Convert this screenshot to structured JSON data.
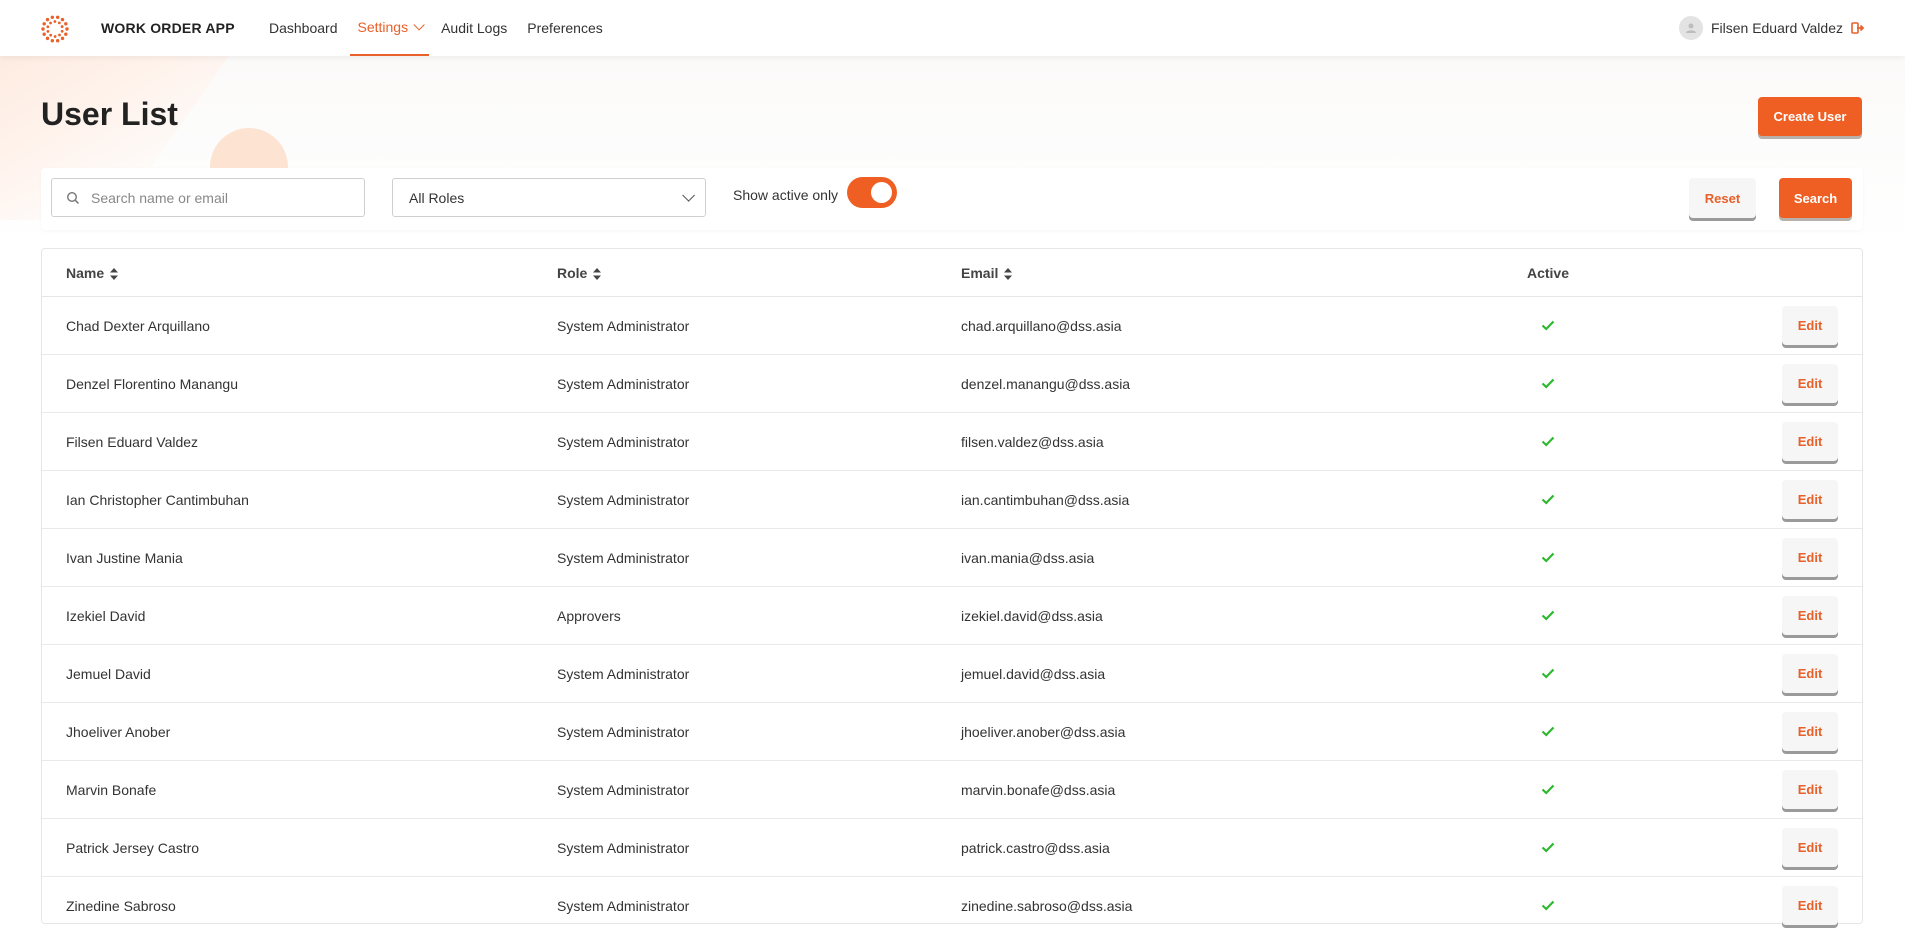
{
  "header": {
    "app_title": "WORK ORDER APP",
    "nav": [
      {
        "label": "Dashboard",
        "active": false
      },
      {
        "label": "Settings",
        "active": true
      },
      {
        "label": "Audit Logs",
        "active": false
      },
      {
        "label": "Preferences",
        "active": false
      }
    ],
    "user_name": "Filsen Eduard Valdez"
  },
  "page": {
    "title": "User List",
    "create_button": "Create User"
  },
  "filters": {
    "search_placeholder": "Search name or email",
    "role_selected": "All Roles",
    "toggle_label": "Show active only",
    "toggle_on": true,
    "reset_label": "Reset",
    "search_label": "Search"
  },
  "table": {
    "headers": {
      "name": "Name",
      "role": "Role",
      "email": "Email",
      "active": "Active"
    },
    "edit_label": "Edit",
    "rows": [
      {
        "name": "Chad Dexter Arquillano",
        "role": "System Administrator",
        "email": "chad.arquillano@dss.asia",
        "active": true
      },
      {
        "name": "Denzel Florentino Manangu",
        "role": "System Administrator",
        "email": "denzel.manangu@dss.asia",
        "active": true
      },
      {
        "name": "Filsen Eduard Valdez",
        "role": "System Administrator",
        "email": "filsen.valdez@dss.asia",
        "active": true
      },
      {
        "name": "Ian Christopher Cantimbuhan",
        "role": "System Administrator",
        "email": "ian.cantimbuhan@dss.asia",
        "active": true
      },
      {
        "name": "Ivan Justine Mania",
        "role": "System Administrator",
        "email": "ivan.mania@dss.asia",
        "active": true
      },
      {
        "name": "Izekiel David",
        "role": "Approvers",
        "email": "izekiel.david@dss.asia",
        "active": true
      },
      {
        "name": "Jemuel David",
        "role": "System Administrator",
        "email": "jemuel.david@dss.asia",
        "active": true
      },
      {
        "name": "Jhoeliver Anober",
        "role": "System Administrator",
        "email": "jhoeliver.anober@dss.asia",
        "active": true
      },
      {
        "name": "Marvin Bonafe",
        "role": "System Administrator",
        "email": "marvin.bonafe@dss.asia",
        "active": true
      },
      {
        "name": "Patrick Jersey Castro",
        "role": "System Administrator",
        "email": "patrick.castro@dss.asia",
        "active": true
      },
      {
        "name": "Zinedine Sabroso",
        "role": "System Administrator",
        "email": "zinedine.sabroso@dss.asia",
        "active": true
      }
    ]
  },
  "colors": {
    "accent": "#ef5f24",
    "check": "#2eb82e"
  },
  "icons": {
    "logo": "sunburst-logo-icon",
    "search": "search-icon",
    "logout": "logout-icon",
    "sort": "sort-icon",
    "check": "check-icon"
  }
}
